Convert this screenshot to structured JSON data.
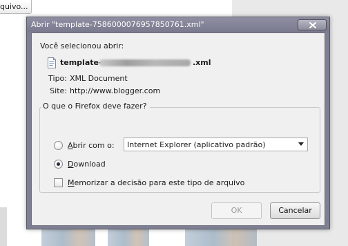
{
  "background": {
    "partial_button_label": "quivo..."
  },
  "dialog": {
    "title": "Abrir \"template-7586000076957850761.xml\"",
    "selected_label": "Você selecionou abrir:",
    "file_name_prefix": "template-",
    "file_name_suffix": ".xml",
    "type_key": "Tipo:",
    "type_value": "XML Document",
    "site_key": "Site:",
    "site_value": "http://www.blogger.com",
    "group_legend": "O que o Firefox deve fazer?",
    "open_with": {
      "access_key": "A",
      "rest": "brir com o:",
      "selected": false
    },
    "app_select_value": "Internet Explorer (aplicativo padrão)",
    "download": {
      "access_key": "D",
      "rest": "ownload",
      "selected": true
    },
    "remember": {
      "access_key": "M",
      "rest": "emorizar a decisão para este tipo de arquivo",
      "checked": false
    },
    "ok_label": "OK",
    "cancel_label": "Cancelar"
  },
  "icons": {
    "close": "close-icon",
    "file": "xml-file-icon",
    "dropdown": "chevron-down-icon"
  },
  "colors": {
    "titlebar": "#7a7a8e",
    "dialog_body": "#f0f0f0",
    "disabled_text": "#9b9b9b"
  }
}
